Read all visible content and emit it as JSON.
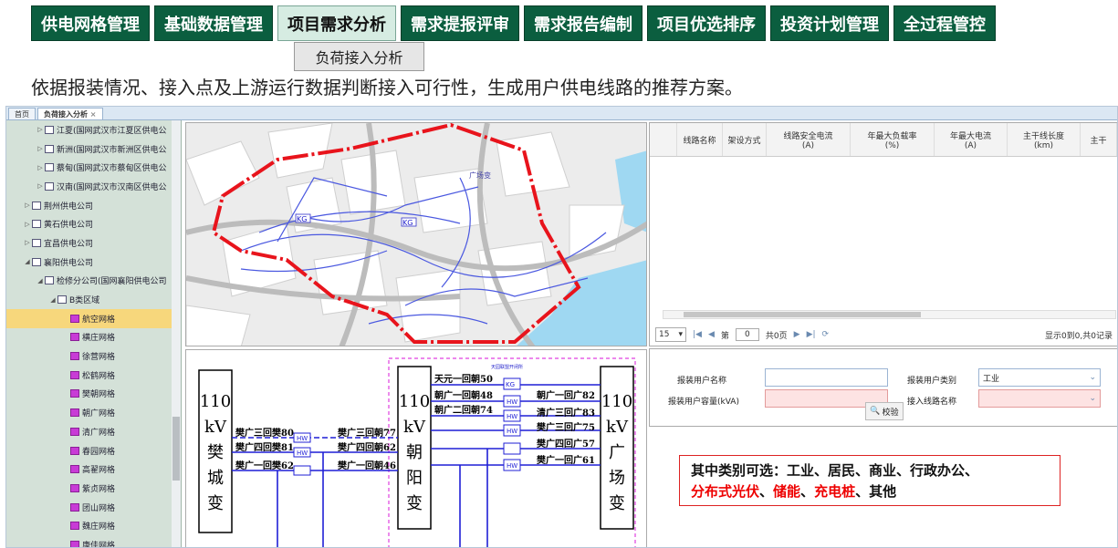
{
  "nav": {
    "items": [
      "供电网格管理",
      "基础数据管理",
      "项目需求分析",
      "需求提报评审",
      "需求报告编制",
      "项目优选排序",
      "投资计划管理",
      "全过程管控"
    ],
    "active_index": 2,
    "submenu": "负荷接入分析"
  },
  "description": "依据报装情况、接入点及上游运行数据判断接入可行性，生成用户供电线路的推荐方案。",
  "tabs": {
    "home": "首页",
    "active": "负荷接入分析",
    "close": "×"
  },
  "tree": [
    {
      "label": "江夏(国网武汉市江夏区供电公",
      "indent": 2,
      "arrow": "▷",
      "icon": "doc"
    },
    {
      "label": "新洲(国网武汉市新洲区供电公",
      "indent": 2,
      "arrow": "▷",
      "icon": "doc"
    },
    {
      "label": "蔡甸(国网武汉市蔡甸区供电公",
      "indent": 2,
      "arrow": "▷",
      "icon": "doc"
    },
    {
      "label": "汉南(国网武汉市汉南区供电公",
      "indent": 2,
      "arrow": "▷",
      "icon": "doc"
    },
    {
      "label": "荆州供电公司",
      "indent": 1,
      "arrow": "▷",
      "icon": "doc"
    },
    {
      "label": "黄石供电公司",
      "indent": 1,
      "arrow": "▷",
      "icon": "doc"
    },
    {
      "label": "宜昌供电公司",
      "indent": 1,
      "arrow": "▷",
      "icon": "doc"
    },
    {
      "label": "襄阳供电公司",
      "indent": 1,
      "arrow": "◢",
      "icon": "doc"
    },
    {
      "label": "检修分公司(国网襄阳供电公司",
      "indent": 2,
      "arrow": "◢",
      "icon": "doc"
    },
    {
      "label": "B类区域",
      "indent": 3,
      "arrow": "◢",
      "icon": "area"
    },
    {
      "label": "航空网格",
      "indent": 4,
      "arrow": "",
      "icon": "grid",
      "selected": true
    },
    {
      "label": "横庄网格",
      "indent": 4,
      "arrow": "",
      "icon": "grid"
    },
    {
      "label": "徐营网格",
      "indent": 4,
      "arrow": "",
      "icon": "grid"
    },
    {
      "label": "松鹤网格",
      "indent": 4,
      "arrow": "",
      "icon": "grid"
    },
    {
      "label": "樊朝网格",
      "indent": 4,
      "arrow": "",
      "icon": "grid"
    },
    {
      "label": "朝广网格",
      "indent": 4,
      "arrow": "",
      "icon": "grid"
    },
    {
      "label": "清广网格",
      "indent": 4,
      "arrow": "",
      "icon": "grid"
    },
    {
      "label": "春园网格",
      "indent": 4,
      "arrow": "",
      "icon": "grid"
    },
    {
      "label": "高翟网格",
      "indent": 4,
      "arrow": "",
      "icon": "grid"
    },
    {
      "label": "紫贞网格",
      "indent": 4,
      "arrow": "",
      "icon": "grid"
    },
    {
      "label": "团山网格",
      "indent": 4,
      "arrow": "",
      "icon": "grid"
    },
    {
      "label": "魏庄网格",
      "indent": 4,
      "arrow": "",
      "icon": "grid"
    },
    {
      "label": "康佳网格",
      "indent": 4,
      "arrow": "",
      "icon": "grid"
    }
  ],
  "map": {
    "labels": [
      "广场变",
      "KG",
      "KG"
    ]
  },
  "table": {
    "columns": [
      "线路名称",
      "架设方式",
      "线路安全电流\n(A)",
      "年最大负载率\n(%)",
      "年最大电流\n(A)",
      "主干线长度\n(km)",
      "主干"
    ]
  },
  "pager": {
    "page_size": "15",
    "page_prefix": "第",
    "page": "0",
    "page_suffix": "共0页",
    "summary": "显示0到0,共0记录"
  },
  "form": {
    "user_name_label": "报装用户名称",
    "user_type_label": "报装用户类别",
    "user_type_value": "工业",
    "capacity_label": "报装用户容量(kVA)",
    "line_label": "接入线路名称",
    "verify": "校验"
  },
  "diagram": {
    "left_station": [
      "110",
      "kV",
      "樊",
      "城",
      "变"
    ],
    "mid_station": [
      "110",
      "kV",
      "朝",
      "阳",
      "变"
    ],
    "right_station": [
      "110",
      "kV",
      "广",
      "场",
      "变"
    ],
    "lines": [
      "樊广三回樊80",
      "樊广四回樊81",
      "樊广一回樊62",
      "樊广三回朝77",
      "樊广四回朝62",
      "樊广一回朝46",
      "天元一回朝50",
      "朝广一回朝48",
      "朝广二回朝74",
      "朝广一回广82",
      "清广三回广83",
      "樊广三回广75",
      "樊广四回广57",
      "樊广一回广61"
    ],
    "switches": [
      "KG",
      "HW",
      "HW",
      "HW",
      "HW",
      "HW",
      "HW"
    ],
    "dash_label": "天园联盟开闭所"
  },
  "note": {
    "line1": "其中类别可选：工业、居民、商业、行政办公、",
    "red1": "分布式光伏",
    "sep1": "、",
    "red2": "储能",
    "sep2": "、",
    "red3": "充电桩",
    "tail": "、其他"
  },
  "colors": {
    "nav_green": "#0b5e3f",
    "route_red": "#e8141c",
    "schematic_blue": "#1f1fd6",
    "dash_magenta": "#e040e0"
  }
}
